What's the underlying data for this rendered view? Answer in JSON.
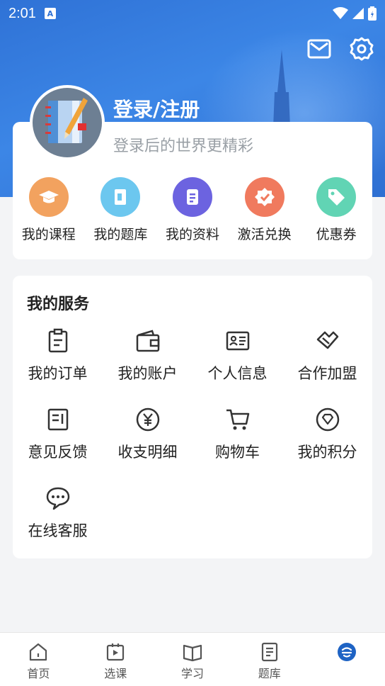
{
  "status_bar": {
    "time": "2:01",
    "badge": "A"
  },
  "header": {
    "message_icon": "mail-icon",
    "settings_icon": "gear-icon",
    "login_title": "登录/注册",
    "subtitle": "登录后的世界更精彩"
  },
  "quick_actions": [
    {
      "label": "我的课程",
      "icon": "graduation-cap-icon",
      "color": "#f2a25f"
    },
    {
      "label": "我的题库",
      "icon": "question-bank-icon",
      "color": "#6cc7ef"
    },
    {
      "label": "我的资料",
      "icon": "document-icon",
      "color": "#6c63e0"
    },
    {
      "label": "激活兑换",
      "icon": "badge-check-icon",
      "color": "#f07a5e"
    },
    {
      "label": "优惠券",
      "icon": "coupon-tag-icon",
      "color": "#61d4b4"
    }
  ],
  "services": {
    "title": "我的服务",
    "items": [
      {
        "label": "我的订单",
        "icon": "clipboard-icon"
      },
      {
        "label": "我的账户",
        "icon": "wallet-icon"
      },
      {
        "label": "个人信息",
        "icon": "id-card-icon"
      },
      {
        "label": "合作加盟",
        "icon": "handshake-icon"
      },
      {
        "label": "意见反馈",
        "icon": "feedback-icon"
      },
      {
        "label": "收支明细",
        "icon": "yen-icon"
      },
      {
        "label": "购物车",
        "icon": "cart-icon"
      },
      {
        "label": "我的积分",
        "icon": "points-icon"
      },
      {
        "label": "在线客服",
        "icon": "chat-icon"
      }
    ]
  },
  "tabs": [
    {
      "label": "首页",
      "icon": "home-icon"
    },
    {
      "label": "选课",
      "icon": "course-select-icon"
    },
    {
      "label": "学习",
      "icon": "book-icon"
    },
    {
      "label": "题库",
      "icon": "question-bank-icon"
    },
    {
      "label": "",
      "icon": "profile-icon",
      "active": true
    }
  ],
  "colors": {
    "brand_blue": "#2f72d6",
    "active_tab": "#1e63c4"
  }
}
